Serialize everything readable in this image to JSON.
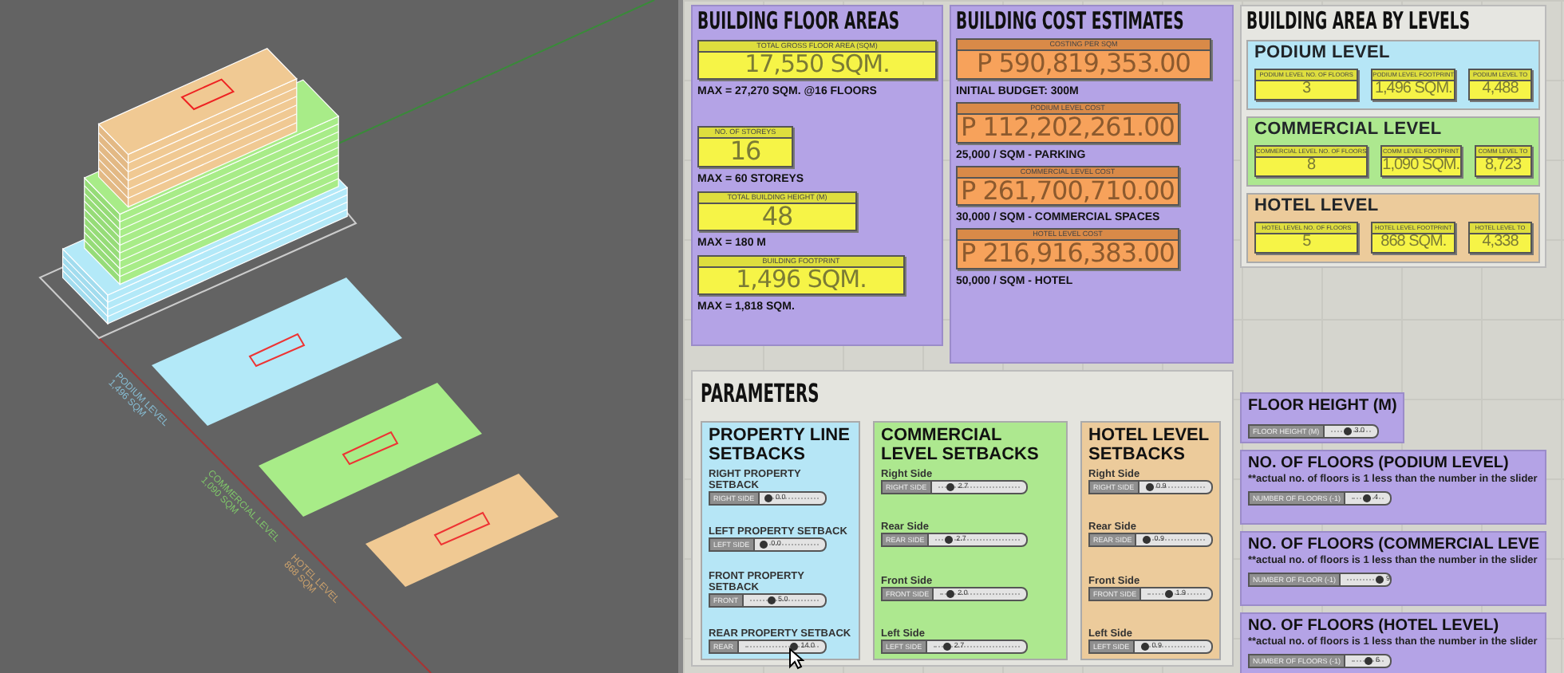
{
  "viewport": {
    "labels": [
      {
        "name": "PODIUM LEVEL",
        "area": "1,496 SQM",
        "color": "#86bcd2"
      },
      {
        "name": "COMMERCIAL LEVEL",
        "area": "1,090 SQM",
        "color": "#7fc46a"
      },
      {
        "name": "HOTEL LEVEL",
        "area": "868 SQM",
        "color": "#c9a06c"
      }
    ]
  },
  "floor_areas": {
    "title": "BUILDING FLOOR AREAS",
    "panels": [
      {
        "label": "TOTAL GROSS FLOOR AREA (SQM)",
        "value": "17,550 SQM.",
        "note": "MAX = 27,270 SQM. @16 FLOORS"
      },
      {
        "label": "NO. OF STOREYS",
        "value": "16",
        "note": "MAX = 60 STOREYS"
      },
      {
        "label": "TOTAL BUILDING HEIGHT (M)",
        "value": "48",
        "note": "MAX = 180 M"
      },
      {
        "label": "BUILDING FOOTPRINT",
        "value": "1,496 SQM.",
        "note": "MAX = 1,818 SQM."
      }
    ]
  },
  "cost_estimates": {
    "title": "BUILDING COST ESTIMATES",
    "panels": [
      {
        "label": "COSTING PER SQM",
        "value": "P 590,819,353.00",
        "note": "INITIAL BUDGET: 300M"
      },
      {
        "label": "PODIUM LEVEL COST",
        "value": "P 112,202,261.00",
        "note": "25,000 / SQM - PARKING"
      },
      {
        "label": "COMMERCIAL LEVEL COST",
        "value": "P 261,700,710.00",
        "note": "30,000 / SQM - COMMERCIAL SPACES"
      },
      {
        "label": "HOTEL LEVEL COST",
        "value": "P 216,916,383.00",
        "note": "50,000 / SQM - HOTEL"
      }
    ]
  },
  "area_by_levels": {
    "title": "BUILDING AREA BY LEVELS",
    "levels": [
      {
        "name": "PODIUM LEVEL",
        "color": "#b6e6f6",
        "panels": [
          {
            "label": "PODIUM LEVEL NO. OF FLOORS",
            "value": "3"
          },
          {
            "label": "PODIUM LEVEL FOOTPRINT",
            "value": "1,496 SQM."
          },
          {
            "label": "PODIUM LEVEL TO",
            "value": "4,488"
          }
        ]
      },
      {
        "name": "COMMERCIAL LEVEL",
        "color": "#ade88f",
        "panels": [
          {
            "label": "COMMERCIAL LEVEL NO. OF FLOORS",
            "value": "8"
          },
          {
            "label": "COMM LEVEL FOOTPRINT",
            "value": "1,090 SQM."
          },
          {
            "label": "COMM LEVEL TO",
            "value": "8,723"
          }
        ]
      },
      {
        "name": "HOTEL LEVEL",
        "color": "#eccb9b",
        "panels": [
          {
            "label": "HOTEL LEVEL NO. OF FLOORS",
            "value": "5"
          },
          {
            "label": "HOTEL LEVEL FOOTPRINT",
            "value": "868 SQM."
          },
          {
            "label": "HOTEL LEVEL TO",
            "value": "4,338"
          }
        ]
      }
    ]
  },
  "parameters": {
    "title": "PARAMETERS",
    "groups": [
      {
        "title": "PROPERTY LINE SETBACKS",
        "color": "#b6e6f6",
        "sliders": [
          {
            "caption": "RIGHT PROPERTY SETBACK",
            "label": "RIGHT SIDE",
            "value": "0.0",
            "level": 0.04
          },
          {
            "caption": "LEFT PROPERTY SETBACK",
            "label": "LEFT SIDE",
            "value": "0.0",
            "level": 0.04
          },
          {
            "caption": "FRONT PROPERTY SETBACK",
            "label": "FRONT",
            "value": "5.0",
            "level": 0.3
          },
          {
            "caption": "REAR PROPERTY SETBACK",
            "label": "REAR",
            "value": "14.0",
            "level": 0.65
          }
        ]
      },
      {
        "title": "COMMERCIAL LEVEL SETBACKS",
        "color": "#ade88f",
        "sliders": [
          {
            "caption": "Right Side",
            "label": "RIGHT SIDE",
            "value": "2.7",
            "level": 0.15
          },
          {
            "caption": "Rear Side",
            "label": "REAR SIDE",
            "value": "2.7",
            "level": 0.15
          },
          {
            "caption": "Front Side",
            "label": "FRONT SIDE",
            "value": "2.0",
            "level": 0.12
          },
          {
            "caption": "Left Side",
            "label": "LEFT SIDE",
            "value": "2.7",
            "level": 0.15
          }
        ]
      },
      {
        "title": "HOTEL LEVEL SETBACKS",
        "color": "#eccb9b",
        "sliders": [
          {
            "caption": "Right Side",
            "label": "RIGHT SIDE",
            "value": "0.9",
            "level": 0.05
          },
          {
            "caption": "Rear Side",
            "label": "REAR SIDE",
            "value": "0.9",
            "level": 0.05
          },
          {
            "caption": "Front Side",
            "label": "FRONT SIDE",
            "value": "1.9",
            "level": 0.35
          },
          {
            "caption": "Left Side",
            "label": "LEFT SIDE",
            "value": "0.9",
            "level": 0.05
          }
        ]
      }
    ]
  },
  "floor_settings": [
    {
      "title": "FLOOR HEIGHT (M)",
      "slider": {
        "label": "FLOOR HEIGHT (M)",
        "value": "3.0",
        "level": 0.4
      }
    },
    {
      "title": "NO. OF FLOORS (PODIUM LEVEL)",
      "note": "**actual no. of floors is 1 less than the number in the slider",
      "slider": {
        "label": "NUMBER OF FLOORS (-1)",
        "value": "4",
        "level": 0.45
      }
    },
    {
      "title": "NO. OF FLOORS (COMMERCIAL LEVE",
      "note": "**actual no. of floors is 1 less than the number in the slider",
      "slider": {
        "label": "NUMBER OF FLOOR (-1)",
        "value": "9",
        "level": 0.85
      }
    },
    {
      "title": "NO. OF FLOORS (HOTEL LEVEL)",
      "note": "**actual no. of floors is 1 less than the number in the slider",
      "slider": {
        "label": "NUMBER OF FLOORS (-1)",
        "value": "6",
        "level": 0.5
      }
    }
  ]
}
